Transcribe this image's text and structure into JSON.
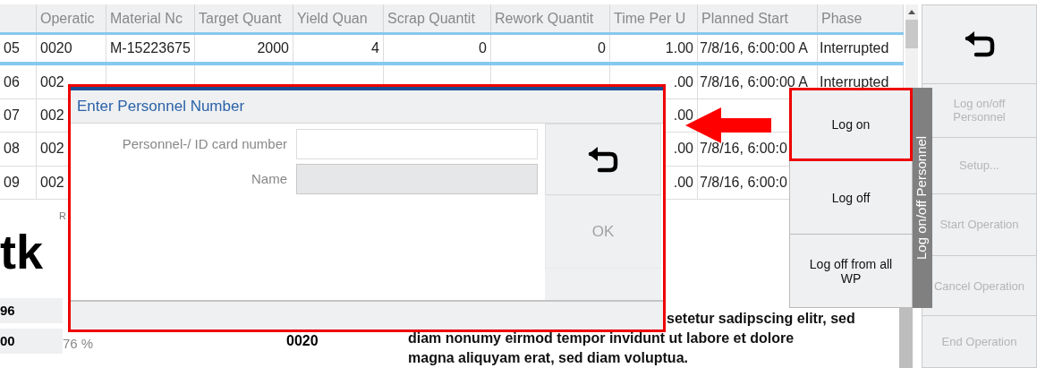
{
  "table": {
    "columns": [
      "Operatic",
      "Material Nc",
      "Target Quant",
      "Yield Quan",
      "Scrap Quantit",
      "Rework Quantit",
      "Time Per U",
      "Planned Start",
      "Phase"
    ],
    "rows": [
      {
        "selected": true,
        "row_number": "05",
        "cells": [
          "0020",
          "M-15223675",
          "2000",
          "4",
          "0",
          "0",
          "1.00",
          "7/8/16, 6:00:00 A",
          "Interrupted"
        ]
      },
      {
        "selected": false,
        "row_number": "06",
        "cells": [
          "002",
          null,
          null,
          null,
          null,
          null,
          ".00",
          "7/8/16, 6:00:00 A",
          "Interrupted"
        ]
      },
      {
        "selected": false,
        "row_number": "07",
        "cells": [
          "002",
          null,
          null,
          null,
          null,
          null,
          ".00",
          null,
          null
        ]
      },
      {
        "selected": false,
        "row_number": "08",
        "cells": [
          "002",
          null,
          null,
          null,
          null,
          null,
          ".00",
          "7/8/16, 6:00:0",
          null
        ]
      },
      {
        "selected": false,
        "row_number": "09",
        "cells": [
          "002",
          null,
          null,
          null,
          null,
          null,
          ".00",
          "7/8/16, 6:00:0",
          null
        ]
      }
    ]
  },
  "report": {
    "label": "R",
    "heading": "tk",
    "rows": [
      {
        "number": "96"
      },
      {
        "number": "00",
        "percent": "76 %",
        "operation": "0020"
      }
    ],
    "paragraph_lines": [
      "setetur sadipscing elitr, sed",
      "diam nonumy eirmod tempor invidunt ut labore et dolore",
      "magna aliquyam erat, sed diam voluptua."
    ]
  },
  "sidebar": {
    "buttons": [
      {
        "kind": "back"
      },
      {
        "kind": "text",
        "label": "Log on/off Personnel",
        "disabled": true
      },
      {
        "kind": "text",
        "label": "Setup...",
        "disabled": true
      },
      {
        "kind": "text",
        "label": "Start Operation",
        "disabled": true
      },
      {
        "kind": "text",
        "label": "Cancel Operation",
        "disabled": true
      },
      {
        "kind": "text",
        "label": "End Operation",
        "disabled": true
      }
    ]
  },
  "popup": {
    "tab_label": "Log on/off Personnel",
    "items": [
      {
        "label": "Log on",
        "highlighted": true
      },
      {
        "label": "Log off",
        "highlighted": false
      },
      {
        "label": "Log off from all WP",
        "highlighted": false
      }
    ]
  },
  "dialog": {
    "title": "Enter Personnel Number",
    "highlighted": true,
    "fields": [
      {
        "label": "Personnel-/ ID card number",
        "disabled": false
      },
      {
        "label": "Name",
        "disabled": true
      }
    ],
    "buttons": [
      {
        "kind": "back"
      },
      {
        "kind": "text",
        "label": "OK",
        "disabled": true
      }
    ]
  }
}
